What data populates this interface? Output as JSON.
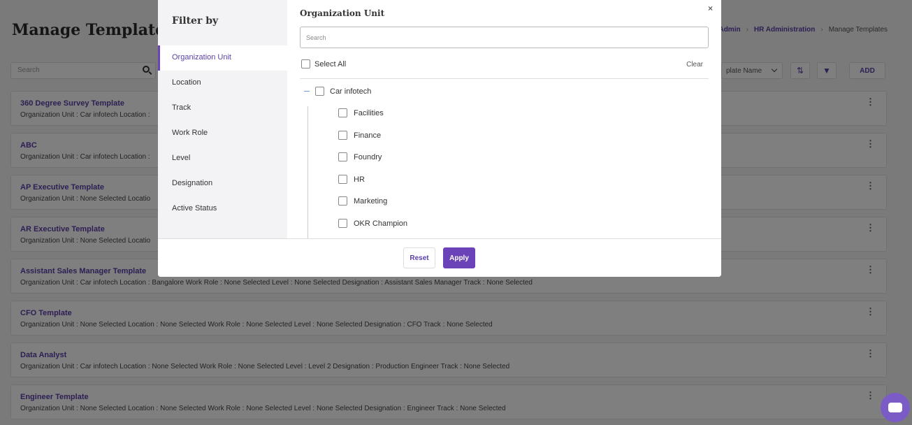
{
  "page": {
    "title": "Manage Templates",
    "breadcrumb": [
      "Admin",
      "HR Administration",
      "Manage Templates"
    ],
    "search_placeholder": "Search",
    "sort_label": "plate Name",
    "add_label": "ADD"
  },
  "templates": [
    {
      "title": "360 Degree Survey Template",
      "meta": "Organization Unit :  Car infotech    Location :"
    },
    {
      "title": "ABC",
      "meta": "Organization Unit :  Car infotech    Location :"
    },
    {
      "title": "AP Executive Template",
      "meta": "Organization Unit :  None Selected    Locatio"
    },
    {
      "title": "AR Executive Template",
      "meta": "Organization Unit :  None Selected    Locatio"
    },
    {
      "title": "Assistant Sales Manager Template",
      "meta": "Organization Unit :  Car infotech    Location :  Bangalore    Work Role :  None Selected    Level :  None Selected    Designation :  Assistant Sales Manager    Track :  None Selected"
    },
    {
      "title": "CFO Template",
      "meta": "Organization Unit :  None Selected    Location :  None Selected    Work Role :  None Selected    Level :  None Selected    Designation :  CFO    Track :  None Selected"
    },
    {
      "title": "Data Analyst",
      "meta": "Organization Unit :  Car infotech    Location :  None Selected    Work Role :  None Selected    Level :  Level 2    Designation :  Production Engineer    Track :  None Selected"
    },
    {
      "title": "Engineer Template",
      "meta": "Organization Unit :  None Selected    Location :  None Selected    Work Role :  None Selected    Level :  None Selected    Designation :  Engineer    Track :  None Selected"
    }
  ],
  "modal": {
    "title": "Filter by",
    "close_label": "×",
    "side_items": [
      "Organization Unit",
      "Location",
      "Track",
      "Work Role",
      "Level",
      "Designation",
      "Active Status"
    ],
    "panel_title": "Organization Unit",
    "search_placeholder": "Search",
    "select_all_label": "Select All",
    "clear_label": "Clear",
    "root": "Car infotech",
    "children": [
      "Facilities",
      "Finance",
      "Foundry",
      "HR",
      "Marketing",
      "OKR Champion"
    ],
    "reset_label": "Reset",
    "apply_label": "Apply"
  }
}
